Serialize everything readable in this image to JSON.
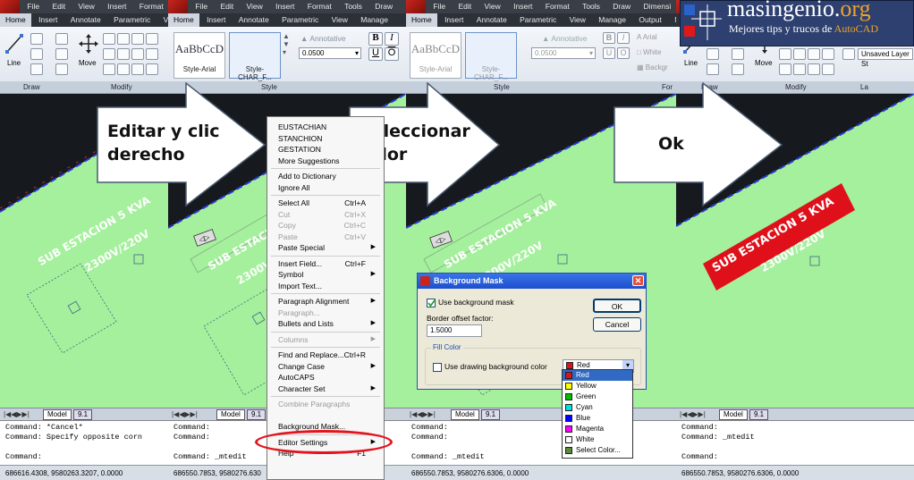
{
  "panel1": {
    "menu": [
      "File",
      "Edit",
      "View",
      "Insert",
      "Format",
      "Vi"
    ],
    "tabs": [
      "Home",
      "Insert",
      "Annotate",
      "Parametric",
      "Vi"
    ],
    "ribbon_labels": [
      "Draw",
      "Modify"
    ],
    "tool_labels": {
      "line": "Line",
      "move": "Move"
    },
    "layout_tabs": [
      "Model",
      "9.1"
    ],
    "command_lines": [
      "Command: *Cancel*",
      "Command: Specify opposite corn",
      "Command:"
    ],
    "status_coords": "686616.4308, 9580263.3207, 0.0000"
  },
  "panel2": {
    "menu": [
      "File",
      "Edit",
      "View",
      "Insert",
      "Format",
      "Tools",
      "Draw"
    ],
    "tabs": [
      "Home",
      "Insert",
      "Annotate",
      "Parametric",
      "View",
      "Manage"
    ],
    "style1": {
      "sample": "AaBbCcD",
      "name": "Style-Arial"
    },
    "style2": {
      "name": "Style-CHAR_F..."
    },
    "annotative": "Annotative",
    "height_value": "0.0500",
    "ribbon_label": "Style",
    "layout_tabs": [
      "Model",
      "9.1"
    ],
    "command_lines": [
      "Command:",
      "Command:",
      "Command: _mtedit"
    ],
    "status_coords": "686550.7853, 9580276.630"
  },
  "panel3": {
    "menu": [
      "File",
      "Edit",
      "View",
      "Insert",
      "Format",
      "Tools",
      "Draw",
      "Dimensi"
    ],
    "tabs": [
      "Home",
      "Insert",
      "Annotate",
      "Parametric",
      "View",
      "Manage",
      "Output",
      "Ne"
    ],
    "style1": {
      "sample": "AaBbCcD",
      "name": "Style-Arial"
    },
    "style2": {
      "name": "Style-CHAR_F..."
    },
    "annotative": "Annotative",
    "height_value": "0.0500",
    "font_value": "Arial",
    "color_value": "White",
    "bg_label": "Backgr",
    "ribbon_labels": [
      "Style",
      "For"
    ],
    "layout_tabs": [
      "Model",
      "9.1"
    ],
    "command_lines": [
      "Command:",
      "Command:",
      "Command: _mtedit"
    ],
    "status_coords": "686550.7853, 9580276.6306, 0.0000"
  },
  "panel4": {
    "tool_labels": {
      "line": "Line",
      "move": "Move"
    },
    "layer_value": "Unsaved Layer St",
    "ribbon_labels": [
      "Draw",
      "Modify",
      "La"
    ],
    "layout_tabs": [
      "Model",
      "9.1"
    ],
    "command_lines": [
      "Command:",
      "Command: _mtedit",
      "Command:"
    ],
    "status_coords": "686550.7853, 9580276.6306, 0.0000"
  },
  "drawing": {
    "line1": "SUB ESTACION 5 KVA",
    "line2": "2300V/220V"
  },
  "arrows": [
    {
      "lines": [
        "Editar y clic",
        "derecho"
      ]
    },
    {
      "lines": [
        "Seleccionar",
        "color"
      ]
    },
    {
      "lines": [
        "Ok"
      ]
    }
  ],
  "context_menu": {
    "items": [
      {
        "label": "EUSTACHIAN"
      },
      {
        "label": "STANCHION"
      },
      {
        "label": "GESTATION"
      },
      {
        "label": "More Suggestions"
      },
      {
        "sep": true
      },
      {
        "label": "Add to Dictionary"
      },
      {
        "label": "Ignore All"
      },
      {
        "sep": true
      },
      {
        "label": "Select All",
        "shortcut": "Ctrl+A"
      },
      {
        "label": "Cut",
        "shortcut": "Ctrl+X",
        "disabled": true
      },
      {
        "label": "Copy",
        "shortcut": "Ctrl+C",
        "disabled": true
      },
      {
        "label": "Paste",
        "shortcut": "Ctrl+V",
        "disabled": true
      },
      {
        "label": "Paste Special",
        "submenu": true
      },
      {
        "sep": true
      },
      {
        "label": "Insert Field...",
        "shortcut": "Ctrl+F"
      },
      {
        "label": "Symbol",
        "submenu": true
      },
      {
        "label": "Import Text..."
      },
      {
        "sep": true
      },
      {
        "label": "Paragraph Alignment",
        "submenu": true
      },
      {
        "label": "Paragraph...",
        "disabled": true
      },
      {
        "label": "Bullets and Lists",
        "submenu": true
      },
      {
        "sep": true
      },
      {
        "label": "Columns",
        "submenu": true,
        "disabled": true
      },
      {
        "sep": true
      },
      {
        "label": "Find and Replace...",
        "shortcut": "Ctrl+R"
      },
      {
        "label": "Change Case",
        "submenu": true
      },
      {
        "label": "AutoCAPS"
      },
      {
        "label": "Character Set",
        "submenu": true
      },
      {
        "sep": true
      },
      {
        "label": "Combine Paragraphs",
        "disabled": true
      },
      {
        "label": "",
        "disabled": true
      },
      {
        "label": "Background Mask..."
      },
      {
        "sep": true
      },
      {
        "label": "Editor Settings",
        "submenu": true
      },
      {
        "label": "Help",
        "shortcut": "F1"
      }
    ]
  },
  "dialog": {
    "title": "Background Mask",
    "use_mask_label": "Use background mask",
    "use_mask_checked": true,
    "offset_label": "Border offset factor:",
    "offset_value": "1.5000",
    "fill_color_label": "Fill Color",
    "use_bg_label": "Use drawing background color",
    "use_bg_checked": false,
    "color_selected": "Red",
    "ok_label": "OK",
    "cancel_label": "Cancel",
    "close_glyph": "✕"
  },
  "color_options": [
    {
      "name": "Red",
      "color": "#e0101a",
      "selected": true
    },
    {
      "name": "Yellow",
      "color": "#ffff00"
    },
    {
      "name": "Green",
      "color": "#00c000"
    },
    {
      "name": "Cyan",
      "color": "#00e0e0"
    },
    {
      "name": "Blue",
      "color": "#0000ff"
    },
    {
      "name": "Magenta",
      "color": "#ff00ff"
    },
    {
      "name": "White",
      "color": "#ffffff"
    },
    {
      "name": "Select Color...",
      "color": "#5a8a3a"
    }
  ],
  "banner": {
    "site_main": "masingenio.",
    "site_ext": "org",
    "tagline_prefix": "Mejores tips y trucos de ",
    "tagline_brand": "AutoCAD"
  },
  "colors": {
    "green_area": "#a4f09c",
    "mask_red": "#e0101a",
    "ellipse": "#e4141e",
    "dialog_title": "#1b4fcf"
  }
}
